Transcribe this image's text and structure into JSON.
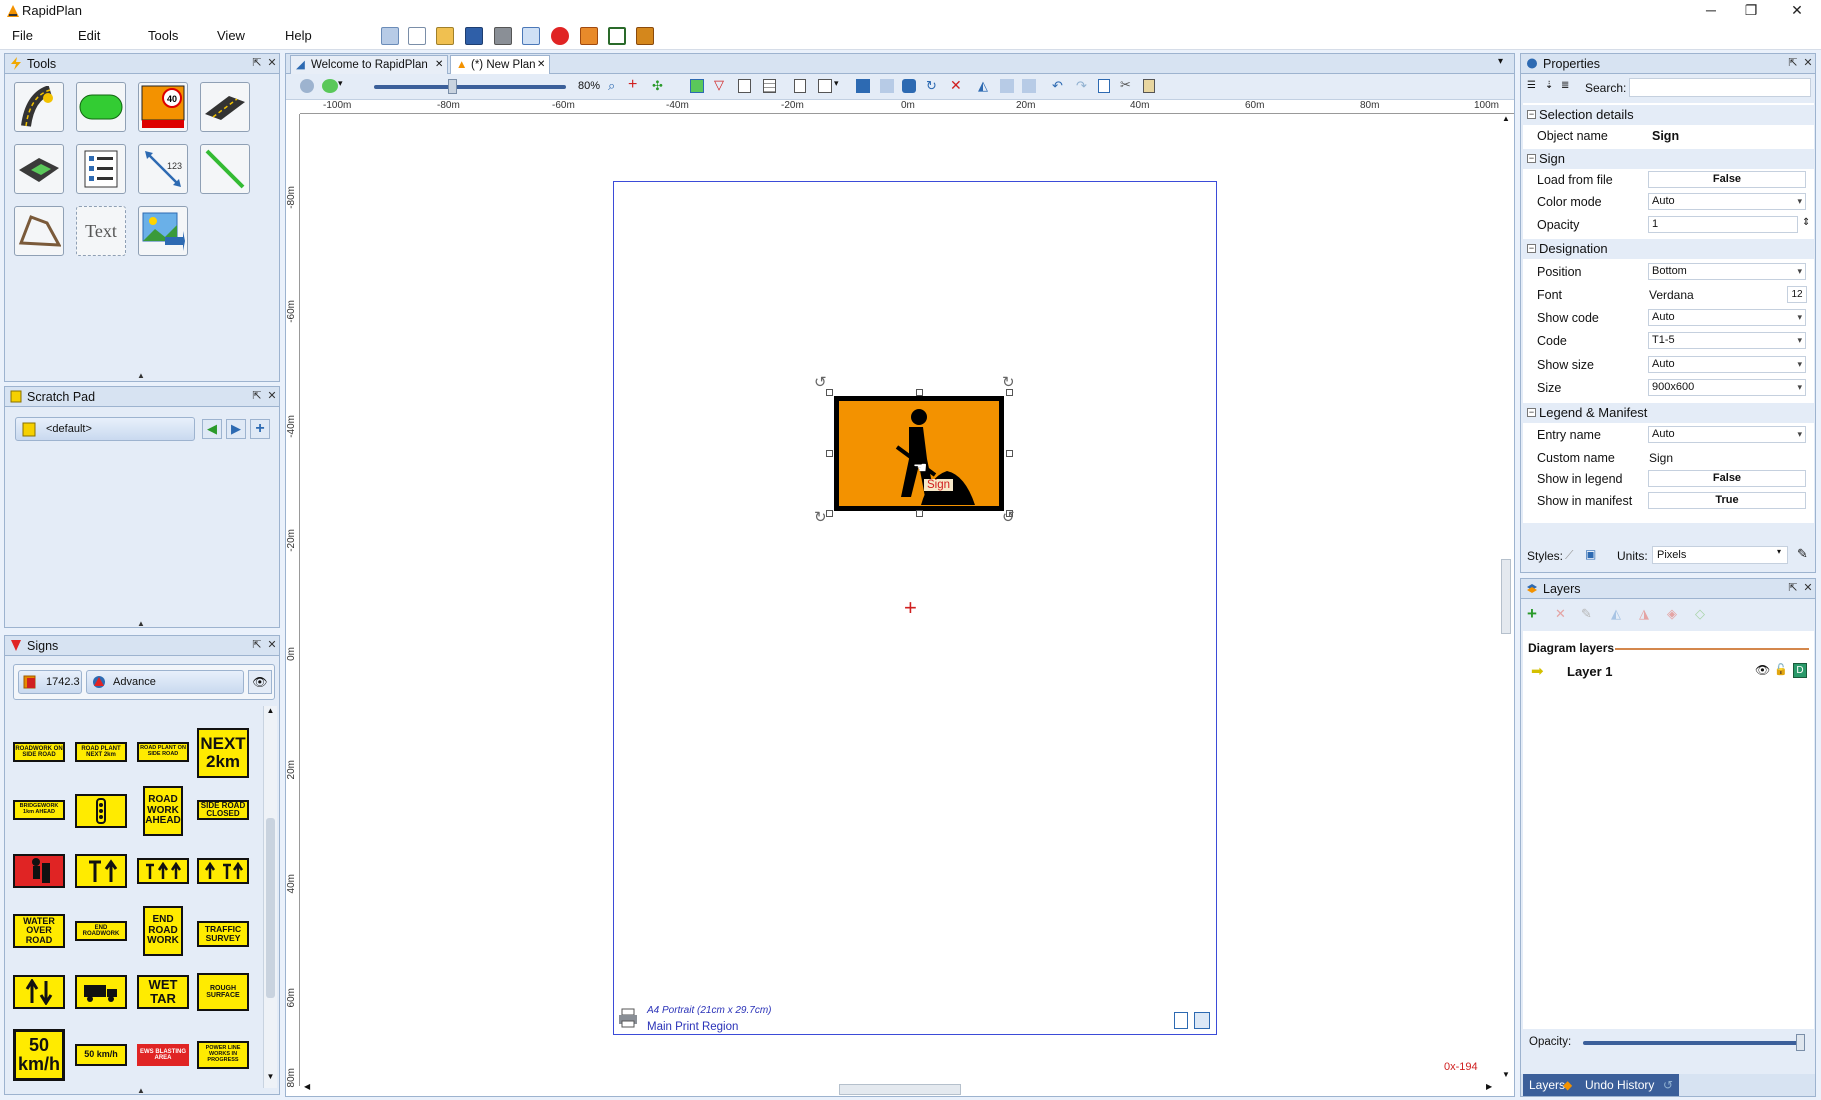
{
  "window": {
    "title": "RapidPlan",
    "minimize": "─",
    "restore": "❐",
    "close": "✕"
  },
  "menu": [
    "File",
    "Edit",
    "Tools",
    "View",
    "Help"
  ],
  "tools_panel": {
    "title": "Tools",
    "text_tool_label": "Text"
  },
  "scratch_pad": {
    "title": "Scratch Pad",
    "selected": "<default>"
  },
  "signs_panel": {
    "title": "Signs",
    "catalog_code": "1742.3",
    "category": "Advance",
    "signs": [
      "ROADWORK ON SIDE ROAD",
      "ROAD PLANT NEXT 2km",
      "ROAD PLANT ON SIDE ROAD",
      "NEXT 2km",
      "BRIDGEWORK 1km AHEAD",
      "",
      "ROAD WORK AHEAD",
      "SIDE ROAD CLOSED",
      "",
      "",
      "",
      "",
      "WATER OVER ROAD",
      "END ROADWORK",
      "END ROAD WORK",
      "TRAFFIC SURVEY",
      "",
      "",
      "WET TAR",
      "ROUGH SURFACE",
      "50 km/h",
      "50 km/h",
      "EWS BLASTING AREA",
      "POWER LINE WORKS IN PROGRESS"
    ]
  },
  "tabs": [
    {
      "label": "Welcome to RapidPlan"
    },
    {
      "label": "(*) New Plan"
    }
  ],
  "canvas": {
    "zoom": "80%",
    "ruler_h": [
      "-100m",
      "-80m",
      "-60m",
      "-40m",
      "-20m",
      "0m",
      "20m",
      "40m",
      "60m",
      "80m",
      "100m"
    ],
    "ruler_v": [
      "-80m",
      "-60m",
      "-40m",
      "-20m",
      "0m",
      "20m",
      "40m",
      "60m",
      "80m"
    ],
    "selected_object_label": "Sign",
    "print_region": {
      "paper": "A4 Portrait (21cm x 29.7cm)",
      "name": "Main Print Region"
    },
    "cursor_coords": "0x-194"
  },
  "properties": {
    "title": "Properties",
    "search_label": "Search:",
    "search_value": "",
    "sections": {
      "selection_details": "Selection details",
      "sign": "Sign",
      "designation": "Designation",
      "legend_manifest": "Legend & Manifest"
    },
    "object_name_label": "Object name",
    "object_name": "Sign",
    "load_from_file_label": "Load from file",
    "load_from_file": "False",
    "color_mode_label": "Color mode",
    "color_mode": "Auto",
    "opacity_label": "Opacity",
    "opacity": "1",
    "position_label": "Position",
    "position": "Bottom",
    "font_label": "Font",
    "font": "Verdana",
    "font_size": "12",
    "show_code_label": "Show code",
    "show_code": "Auto",
    "code_label": "Code",
    "code": "T1-5",
    "show_size_label": "Show size",
    "show_size": "Auto",
    "size_label": "Size",
    "size": "900x600",
    "entry_name_label": "Entry name",
    "entry_name": "Auto",
    "custom_name_label": "Custom name",
    "custom_name": "Sign",
    "show_in_legend_label": "Show in legend",
    "show_in_legend": "False",
    "show_in_manifest_label": "Show in manifest",
    "show_in_manifest": "True",
    "styles_label": "Styles:",
    "units_label": "Units:",
    "units": "Pixels"
  },
  "layers": {
    "title": "Layers",
    "diagram_layers_label": "Diagram layers",
    "items": [
      {
        "name": "Layer 1"
      }
    ],
    "opacity_label": "Opacity:",
    "opacity_value": 1.0,
    "bottom_tabs": [
      "Layers",
      "Undo History"
    ]
  },
  "colors": {
    "accent": "#2d6ab2",
    "sign_orange": "#f39200",
    "sign_yellow": "#ffeb00",
    "selection": "#3b4bd8"
  }
}
